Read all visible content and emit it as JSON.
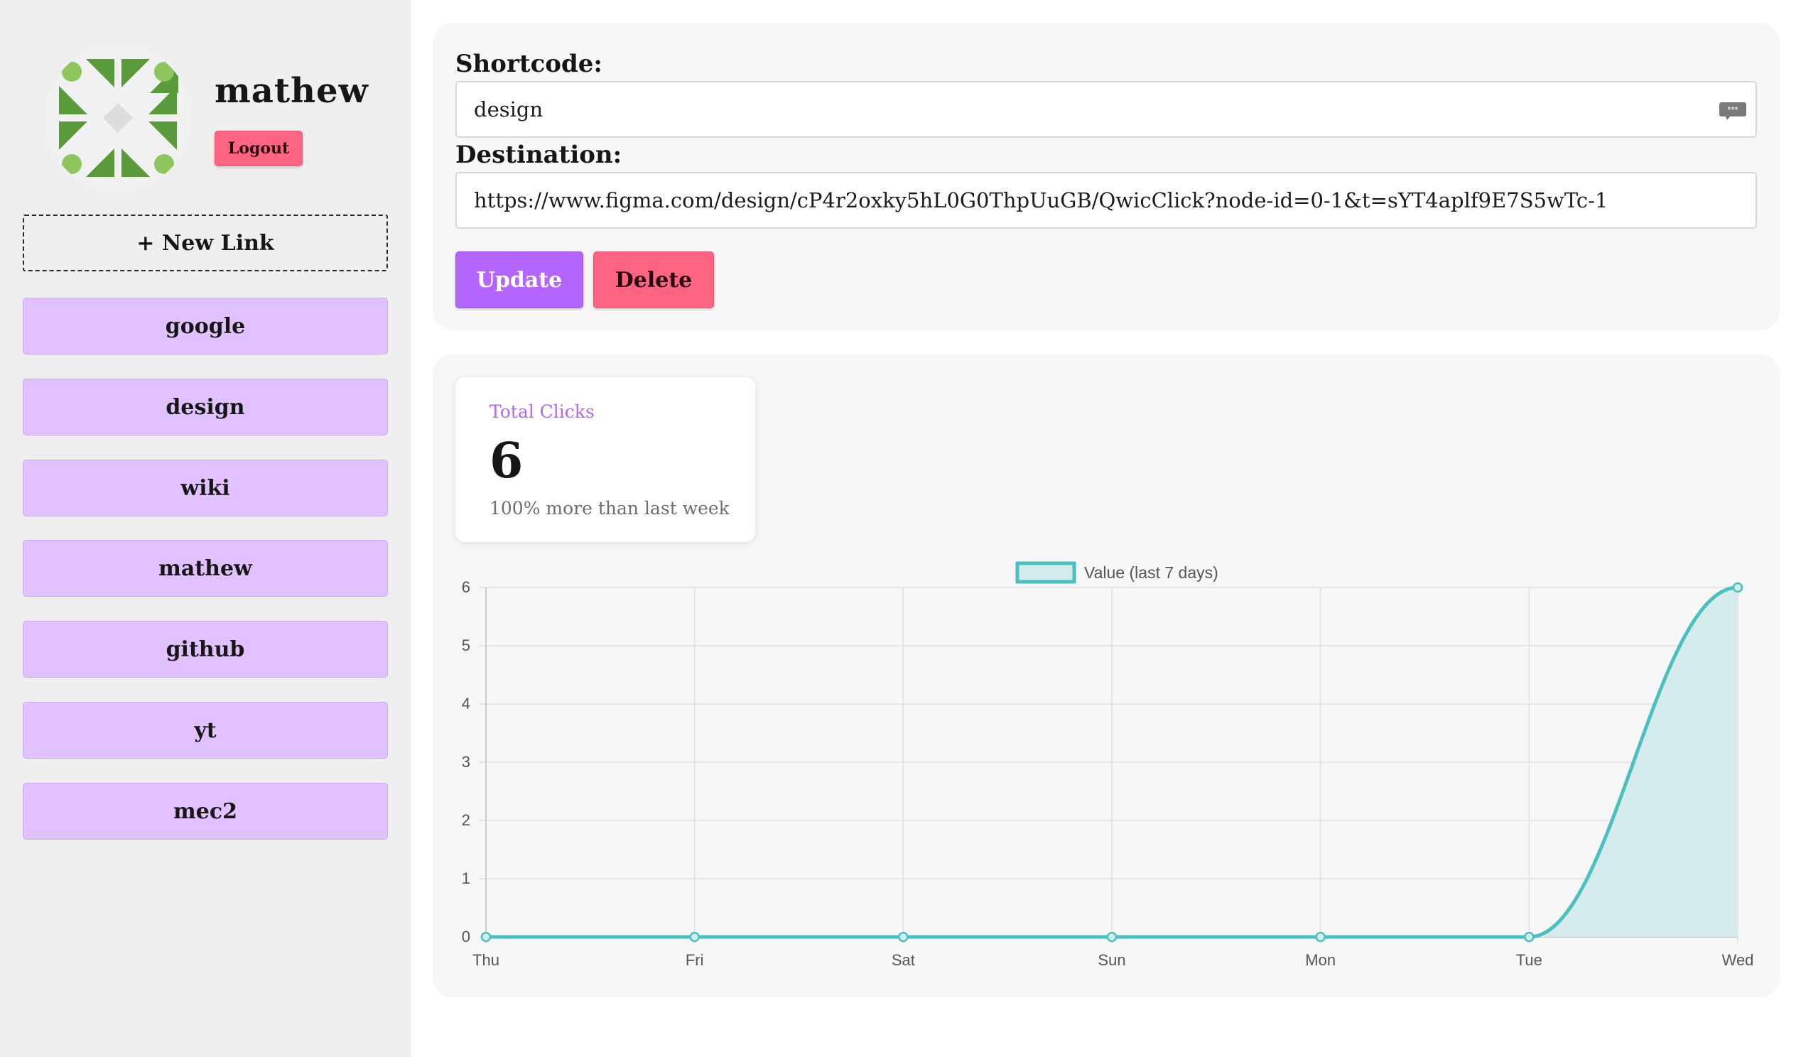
{
  "sidebar": {
    "username": "mathew",
    "logout_label": "Logout",
    "new_link_label": "+ New Link",
    "links": [
      "google",
      "design",
      "wiki",
      "mathew",
      "github",
      "yt",
      "mec2"
    ]
  },
  "editor": {
    "shortcode_label": "Shortcode:",
    "shortcode_value": "design",
    "destination_label": "Destination:",
    "destination_value": "https://www.figma.com/design/cP4r2oxky5hL0G0ThpUuGB/QwicClick?node-id=0-1&t=sYT4aplf9E7S5wTc-1",
    "update_label": "Update",
    "delete_label": "Delete",
    "password_icon": "password-manager-icon"
  },
  "stats": {
    "title": "Total Clicks",
    "value": "6",
    "description": "100% more than last week"
  },
  "colors": {
    "accent_purple": "#b565ff",
    "danger_pink": "#ff6482",
    "link_purple": "#e1c1ff",
    "chart_line": "#4bc0c0",
    "chart_fill": "#d4ebeb"
  },
  "chart_data": {
    "type": "area",
    "categories": [
      "Thu",
      "Fri",
      "Sat",
      "Sun",
      "Mon",
      "Tue",
      "Wed"
    ],
    "series": [
      {
        "name": "Value (last 7 days)",
        "values": [
          0,
          0,
          0,
          0,
          0,
          0,
          6
        ]
      }
    ],
    "ylim": [
      0,
      6
    ],
    "yticks": [
      0,
      1,
      2,
      3,
      4,
      5,
      6
    ],
    "grid": true,
    "legend": "top-center"
  }
}
